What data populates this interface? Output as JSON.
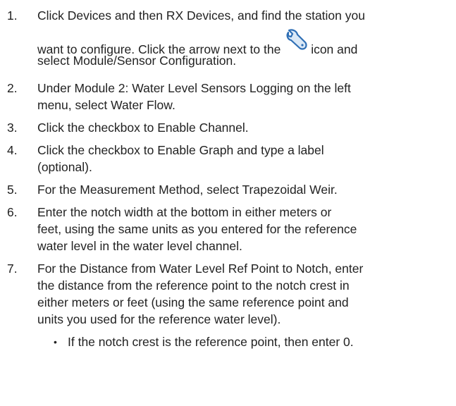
{
  "steps": [
    {
      "number": "1.",
      "lines": [
        "Click Devices and then RX Devices, and find the station you",
        "want to configure. Click the arrow next to the",
        "icon and",
        "select Module/Sensor Configuration."
      ]
    },
    {
      "number": "2.",
      "lines": [
        "Under Module 2: Water Level Sensors Logging on the left",
        "menu, select Water Flow."
      ]
    },
    {
      "number": "3.",
      "lines": [
        "Click the checkbox to Enable Channel."
      ]
    },
    {
      "number": "4.",
      "lines": [
        "Click the checkbox to Enable Graph and type a label",
        "(optional)."
      ]
    },
    {
      "number": "5.",
      "lines": [
        "For the Measurement Method, select Trapezoidal Weir."
      ]
    },
    {
      "number": "6.",
      "lines": [
        "Enter the notch width at the bottom in either meters or",
        "feet, using the same units as you entered for the reference",
        "water level in the water level channel."
      ]
    },
    {
      "number": "7.",
      "lines": [
        "For the Distance from Water Level Ref Point to Notch, enter",
        "the distance from the reference point to the notch crest in",
        "either meters or feet (using the same reference point and",
        "units you used for the reference water level)."
      ]
    }
  ],
  "bullet": {
    "symbol": "•",
    "text": "If the notch crest is the reference point, then enter 0."
  },
  "icons": {
    "settings": "wrench-icon"
  },
  "colors": {
    "text": "#222222",
    "icon_stroke": "#2f6fb5",
    "icon_fill": "#dbe9f7"
  }
}
